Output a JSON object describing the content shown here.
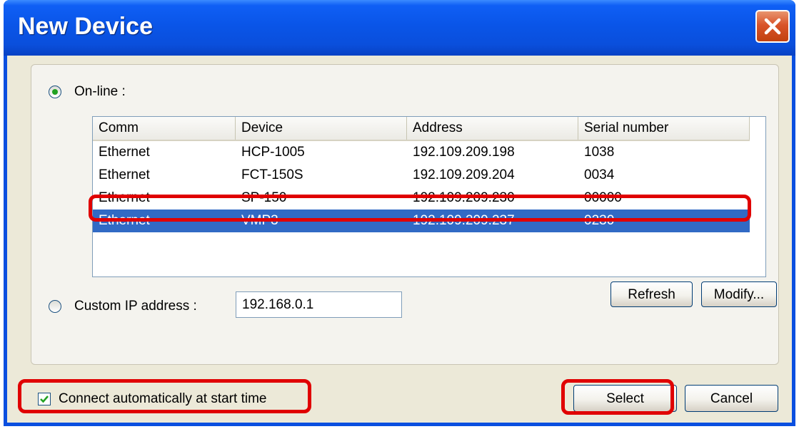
{
  "window": {
    "title": "New Device"
  },
  "online": {
    "label": "On-line :"
  },
  "list": {
    "columns": [
      "Comm",
      "Device",
      "Address",
      "Serial number"
    ],
    "rows": [
      [
        "Ethernet",
        "HCP-1005",
        "192.109.209.198",
        "1038"
      ],
      [
        "Ethernet",
        "FCT-150S",
        "192.109.209.204",
        "0034"
      ],
      [
        "Ethernet",
        "SP-150",
        "192.109.209.230",
        "00000"
      ],
      [
        "Ethernet",
        "VMP3",
        "192.109.209.237",
        "0230"
      ]
    ],
    "selected_row": 3
  },
  "custom_ip": {
    "label": "Custom IP address :",
    "value": "192.168.0.1"
  },
  "buttons": {
    "refresh": "Refresh",
    "modify": "Modify...",
    "select": "Select",
    "cancel": "Cancel"
  },
  "auto_connect": {
    "label": "Connect automatically at start time",
    "checked": true
  },
  "colors": {
    "title_bar": "#0a55e8",
    "selection": "#316ac5",
    "highlight": "#e00000",
    "close_button": "#d9542a"
  }
}
